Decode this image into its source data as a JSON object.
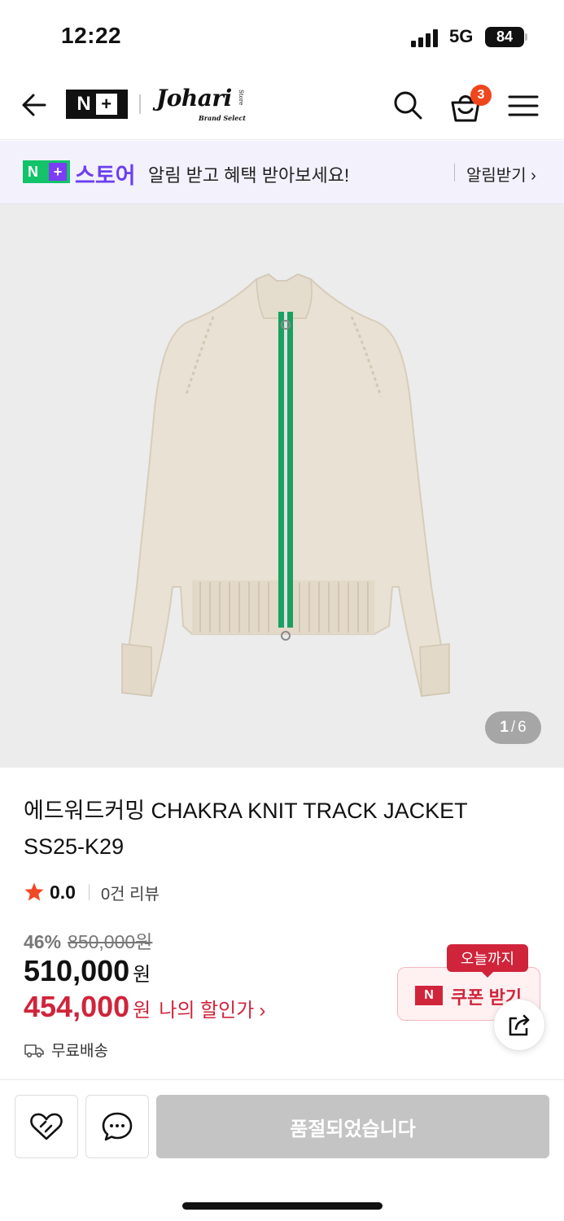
{
  "status_bar": {
    "time": "12:22",
    "network": "5G",
    "battery": "84"
  },
  "header": {
    "back_icon": "arrow-left-icon",
    "platform_logo": {
      "n": "N",
      "plus": "+"
    },
    "brand": {
      "name": "Johari",
      "sub": "Brand Select",
      "store": "Store"
    },
    "search_icon": "search-icon",
    "cart_icon": "shopping-bag-icon",
    "cart_count": "3",
    "menu_icon": "hamburger-menu-icon"
  },
  "promo_banner": {
    "logo": {
      "n": "N",
      "plus": "+"
    },
    "store_label": "스토어",
    "message": "알림 받고 혜택 받아보세요!",
    "link_label": "알림받기 ›"
  },
  "product_image": {
    "current": "1",
    "separator": "/",
    "total": "6"
  },
  "product": {
    "title_line1": "에드워드커밍 CHAKRA KNIT TRACK JACKET",
    "title_line2": "SS25-K29",
    "rating": "0.0",
    "review_count": "0건 리뷰",
    "discount_rate": "46%",
    "original_price": "850,000원",
    "sale_price": "510,000",
    "sale_currency": "원",
    "my_price": "454,000",
    "my_price_currency": "원",
    "my_price_label": "나의 할인가",
    "my_price_chevron": "›",
    "shipping": "무료배송"
  },
  "coupon": {
    "tag": "오늘까지",
    "badge": "N",
    "label": "쿠폰 받기"
  },
  "bottom_bar": {
    "soldout_label": "품절되었습니다"
  },
  "colors": {
    "accent_red": "#d0243b",
    "naver_green": "#12c36a",
    "store_purple": "#6b3ff0",
    "cart_badge": "#f0461e",
    "zipper_green": "#1aa060",
    "knit_beige": "#e9e1d3"
  }
}
